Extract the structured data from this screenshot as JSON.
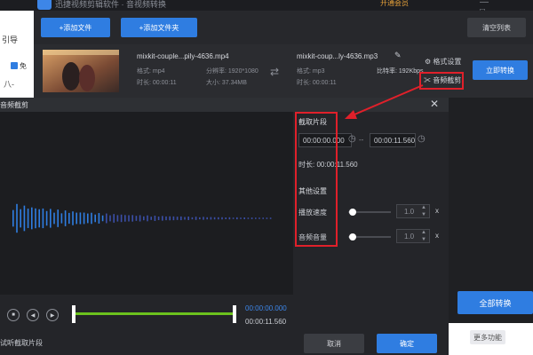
{
  "app": {
    "title": "迅捷视频剪辑软件 · 音视频转换",
    "vip": "开通会员",
    "window_controls": "— □ ✕"
  },
  "sidepanel": {
    "guide": "引导",
    "free_label": "免",
    "tab_label": "八-"
  },
  "toolbar": {
    "add_file": "+添加文件",
    "add_folder": "+添加文件夹",
    "clear_list": "清空列表"
  },
  "file_row": {
    "source": {
      "name": "mixkit-couple...pily-4636.mp4",
      "format": "格式: mp4",
      "resolution": "分辨率: 1920*1080",
      "duration": "时长: 00:00:11",
      "size": "大小: 37.34MB"
    },
    "target": {
      "name": "mixkit-coup...ly-4636.mp3",
      "format": "格式: mp3",
      "bitrate": "比特率: 192Kbps",
      "duration": "时长: 00:00:11"
    },
    "format_settings": "格式设置",
    "audio_clip": "音频截剪",
    "convert_now": "立即转换"
  },
  "dialog": {
    "title": "音频截剪",
    "section_title": "截取片段",
    "start_time": "00:00:00.000",
    "dash": "--",
    "end_time": "00:00:11.560",
    "duration_label": "时长:",
    "duration_value": "00:00:11.560",
    "other_settings": "其他设置",
    "speed_label": "播放速度",
    "speed_value": "1.0",
    "speed_level": 0.1,
    "volume_label": "音频音量",
    "volume_value": "1.0",
    "volume_level": 0.1,
    "x_unit": "x",
    "time_top": "00:00:00.000",
    "time_bottom": "00:00:11.560",
    "selected_fraction": 1.0,
    "listen_label": "试听截取片段",
    "cancel": "取消",
    "confirm": "确定"
  },
  "main_right": {
    "convert_all": "全部转换",
    "more_functions": "更多功能"
  },
  "colors": {
    "accent": "#2f7de1",
    "red_annotation": "#e0202a",
    "wave": "#2f7de1",
    "progress": "#6cc21e"
  }
}
